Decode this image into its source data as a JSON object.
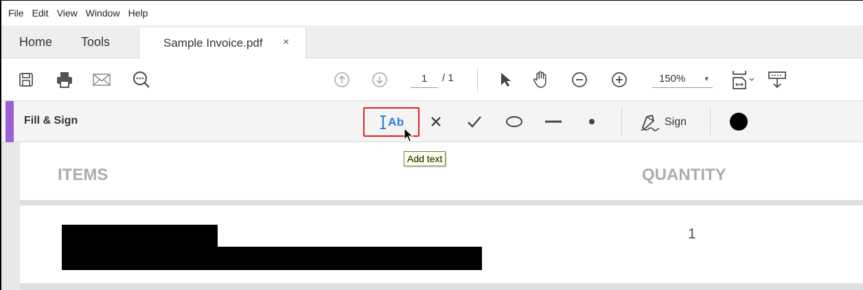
{
  "menu": [
    "File",
    "Edit",
    "View",
    "Window",
    "Help"
  ],
  "tabs": {
    "home": "Home",
    "tools": "Tools",
    "document": "Sample Invoice.pdf",
    "close": "×"
  },
  "toolbar": {
    "icons": [
      "save-icon",
      "print-icon",
      "email-icon",
      "search-icon",
      "page-up-icon",
      "page-down-icon",
      "select-pointer-icon",
      "hand-icon",
      "zoom-out-icon",
      "zoom-in-icon",
      "fit-page-icon",
      "scroll-mode-icon"
    ],
    "current_page": "1",
    "page_total": "/ 1",
    "zoom": "150%",
    "zoom_caret": "▾"
  },
  "fill_sign": {
    "title": "Fill & Sign",
    "add_text_label": "Ab",
    "sign_label": "Sign",
    "accent_color": "#9b5fd6",
    "highlight_color": "#e02020",
    "tools": [
      "cross-icon",
      "checkmark-icon",
      "ellipse-icon",
      "line-icon",
      "dot-icon",
      "sign-pen-icon",
      "color-circle-icon"
    ]
  },
  "tooltip": "Add text",
  "document": {
    "items_header": "ITEMS",
    "quantity_header": "QUANTITY",
    "row_quantity": "1"
  }
}
